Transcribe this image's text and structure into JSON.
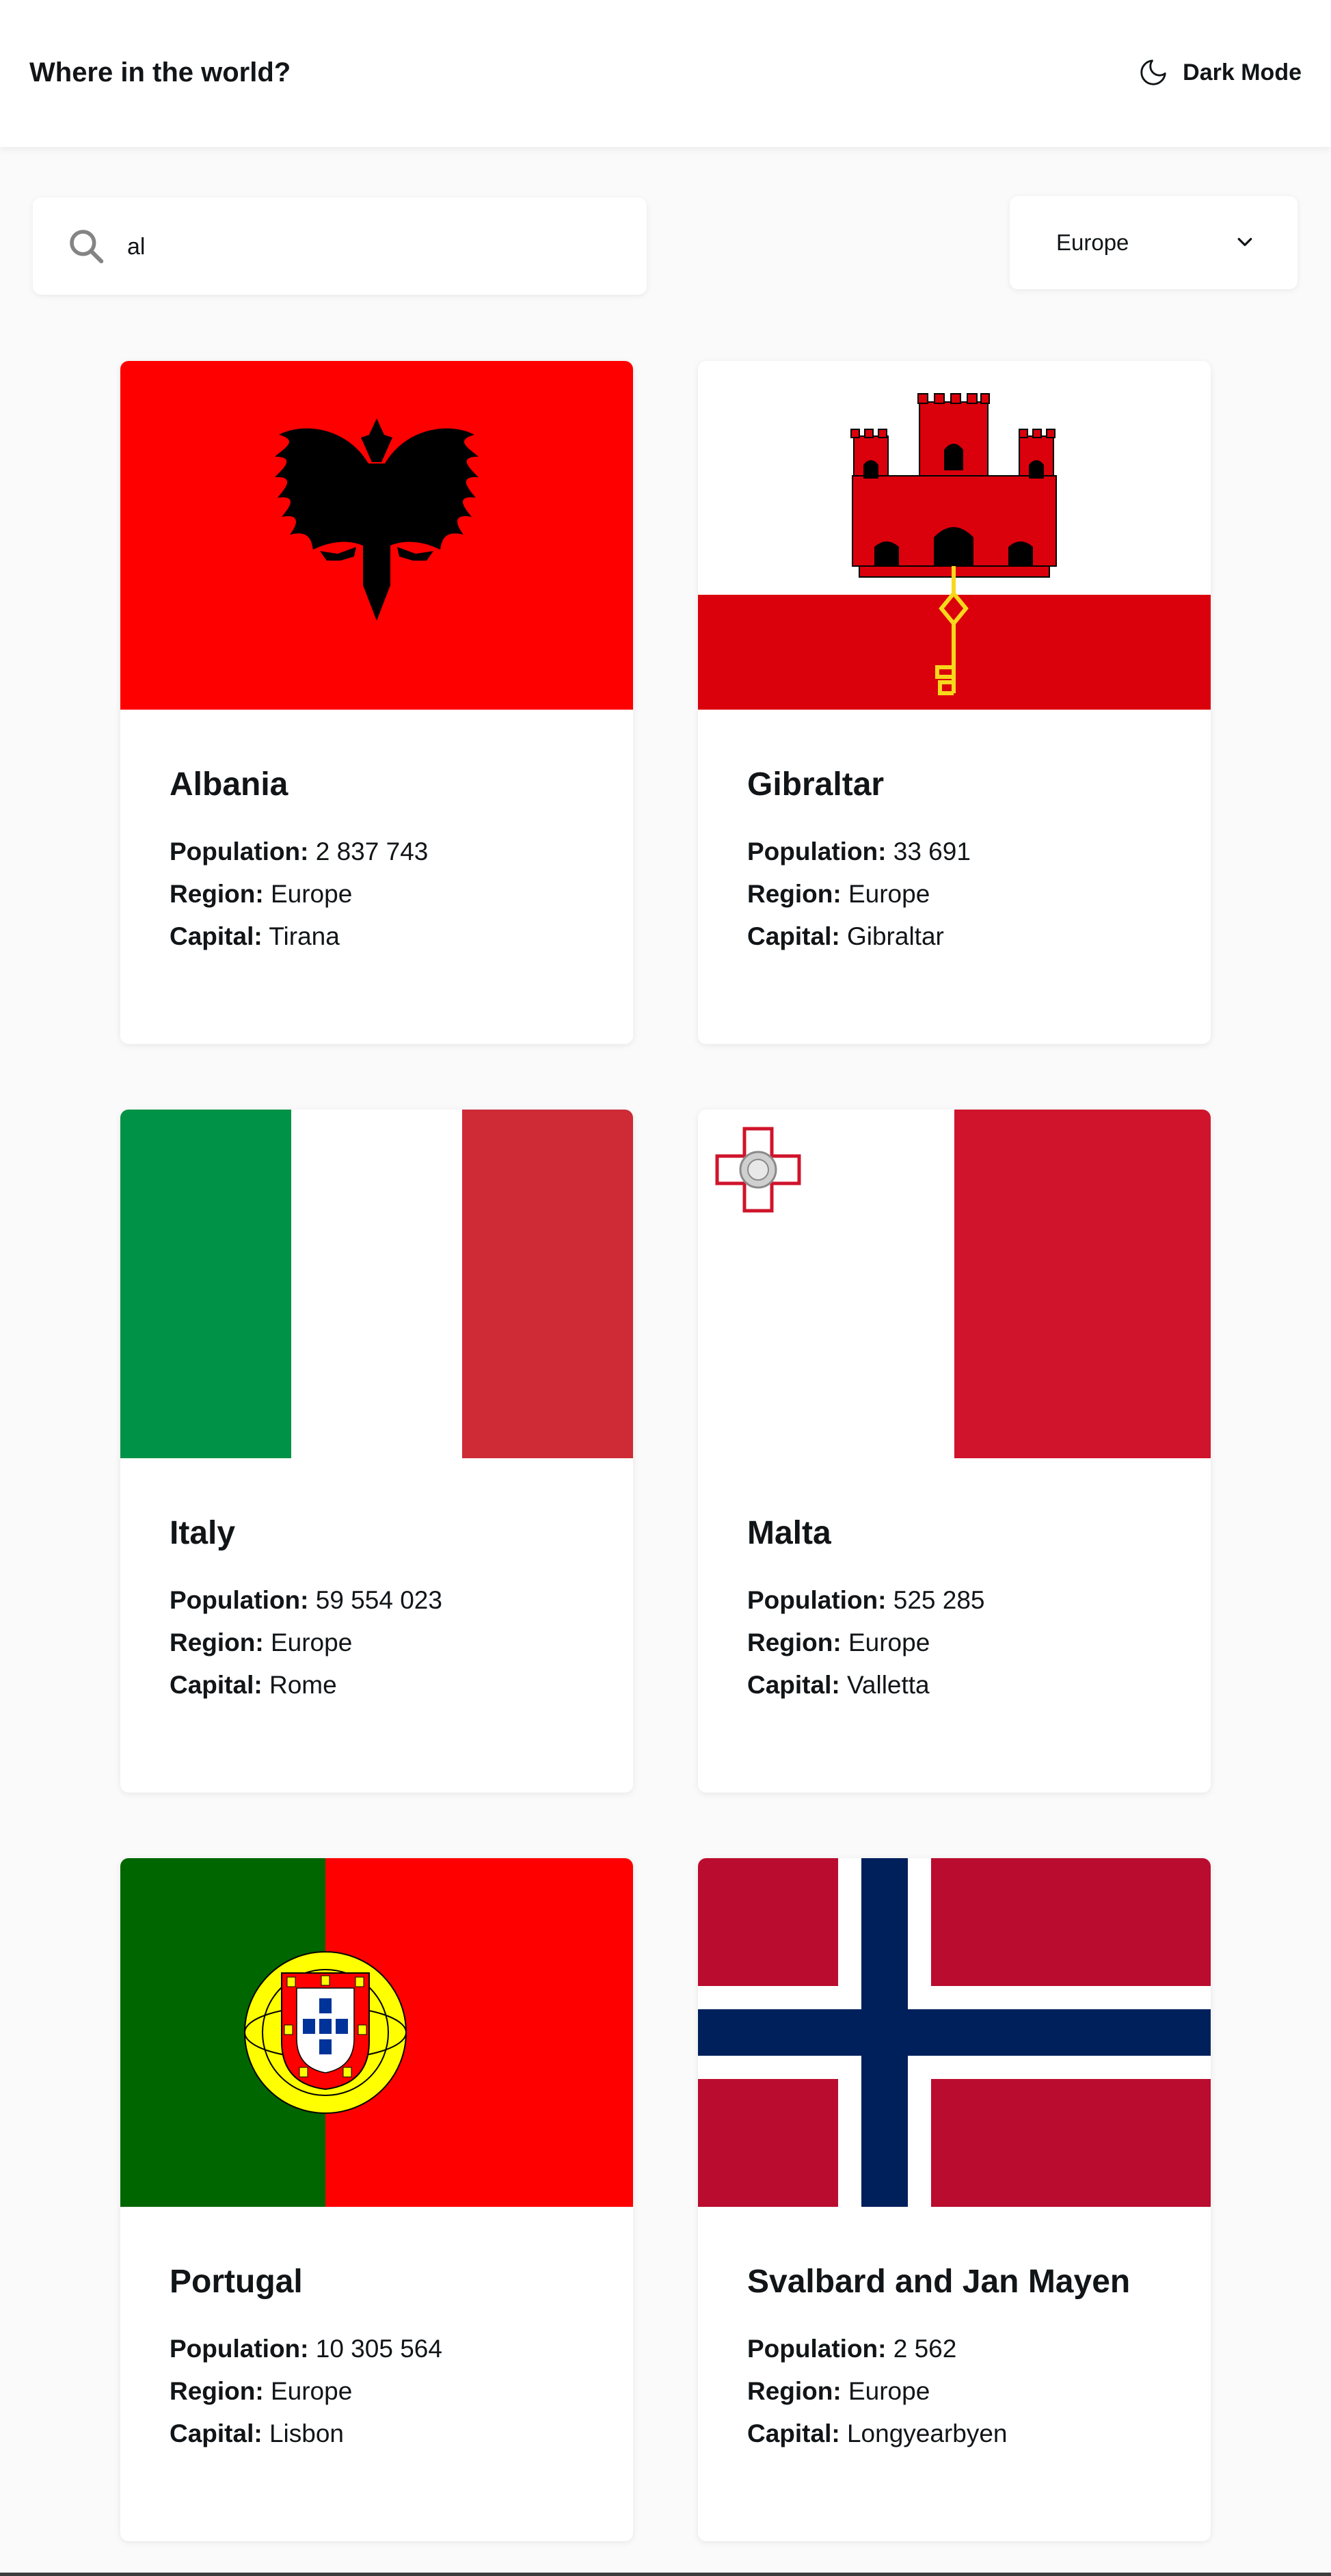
{
  "header": {
    "title": "Where in the world?",
    "mode_label": "Dark Mode",
    "mode_icon": "moon-icon"
  },
  "search": {
    "value": "al",
    "icon": "search-icon"
  },
  "filter": {
    "selected": "Europe",
    "icon": "chevron-down-icon"
  },
  "labels": {
    "population": "Population:",
    "region": "Region:",
    "capital": "Capital:"
  },
  "countries": [
    {
      "name": "Albania",
      "population": "2 837 743",
      "region": "Europe",
      "capital": "Tirana"
    },
    {
      "name": "Gibraltar",
      "population": "33 691",
      "region": "Europe",
      "capital": "Gibraltar"
    },
    {
      "name": "Italy",
      "population": "59 554 023",
      "region": "Europe",
      "capital": "Rome"
    },
    {
      "name": "Malta",
      "population": "525 285",
      "region": "Europe",
      "capital": "Valletta"
    },
    {
      "name": "Portugal",
      "population": "10 305 564",
      "region": "Europe",
      "capital": "Lisbon"
    },
    {
      "name": "Svalbard and Jan Mayen",
      "population": "2 562",
      "region": "Europe",
      "capital": "Longyearbyen"
    }
  ],
  "colors": {
    "background": "#fafafa",
    "element": "#ffffff",
    "text": "#111517"
  }
}
